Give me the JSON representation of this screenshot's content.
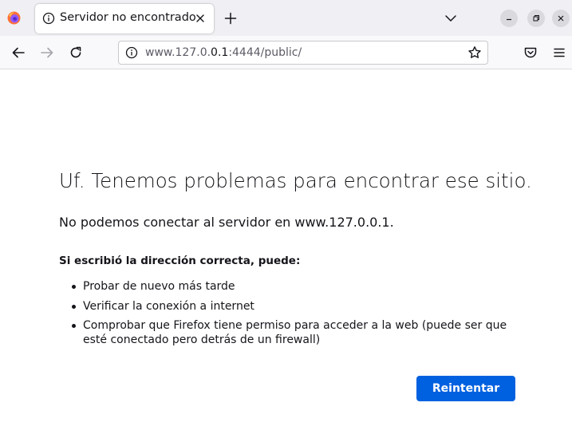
{
  "browser": {
    "tab": {
      "title": "Servidor no encontrado"
    },
    "url": {
      "prefix": "www.127.0.",
      "host_highlight": "0.1",
      "suffix": ":4444/public/"
    }
  },
  "icons": {
    "logo": "firefox-logo-icon",
    "tab_info": "info-icon",
    "tab_close": "close-icon",
    "new_tab": "plus-icon",
    "tab_list": "chevron-down-icon",
    "minimize": "minimize-icon",
    "restore": "restore-icon",
    "close_window": "close-icon",
    "back": "back-arrow-icon",
    "forward": "forward-arrow-icon",
    "reload": "reload-icon",
    "site_info": "info-icon",
    "bookmark": "star-icon",
    "pocket": "pocket-icon",
    "menu": "hamburger-menu-icon"
  },
  "colors": {
    "accent": "#0061e0",
    "tabstrip_bg": "#f0f0f4",
    "text": "#15141a"
  },
  "error_page": {
    "title": "Uf. Tenemos problemas para encontrar ese sitio.",
    "description": "No podemos conectar al servidor en www.127.0.0.1.",
    "subtitle": "Si escribió la dirección correcta, puede:",
    "suggestions": [
      "Probar de nuevo más tarde",
      "Verificar la conexión a internet",
      "Comprobar que Firefox tiene permiso para acceder a la web (puede ser que esté conectado pero detrás de un firewall)"
    ],
    "retry_label": "Reintentar"
  }
}
